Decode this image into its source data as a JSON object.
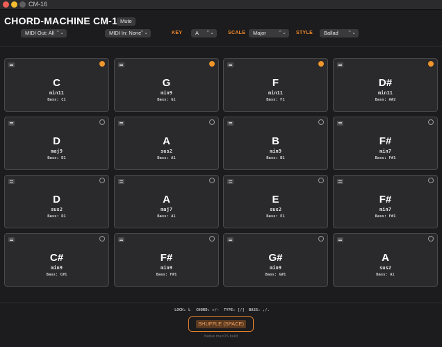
{
  "window": {
    "title": "CM-16"
  },
  "header": {
    "app_title": "CHORD-MACHINE CM-16",
    "mute_label": "Mute"
  },
  "controls": {
    "midi_out": "MIDI Out: All",
    "midi_in": "MIDI In: None",
    "key_label": "KEY",
    "key_value": "A",
    "scale_label": "SCALE",
    "scale_value": "Major",
    "style_label": "STYLE",
    "style_value": "Ballad"
  },
  "pads": [
    {
      "root": "C",
      "quality": "min11",
      "bass": "Bass: C1",
      "active": true
    },
    {
      "root": "G",
      "quality": "min9",
      "bass": "Bass: G1",
      "active": true
    },
    {
      "root": "F",
      "quality": "min11",
      "bass": "Bass: F1",
      "active": true
    },
    {
      "root": "D#",
      "quality": "min11",
      "bass": "Bass: A#2",
      "active": true
    },
    {
      "root": "D",
      "quality": "maj9",
      "bass": "Bass: D1",
      "active": false
    },
    {
      "root": "A",
      "quality": "sus2",
      "bass": "Bass: A1",
      "active": false
    },
    {
      "root": "B",
      "quality": "min9",
      "bass": "Bass: B1",
      "active": false
    },
    {
      "root": "F#",
      "quality": "min7",
      "bass": "Bass: F#1",
      "active": false
    },
    {
      "root": "D",
      "quality": "sus2",
      "bass": "Bass: D1",
      "active": false
    },
    {
      "root": "A",
      "quality": "maj7",
      "bass": "Bass: A1",
      "active": false
    },
    {
      "root": "E",
      "quality": "sus2",
      "bass": "Bass: E1",
      "active": false
    },
    {
      "root": "F#",
      "quality": "min7",
      "bass": "Bass: F#1",
      "active": false
    },
    {
      "root": "C#",
      "quality": "min9",
      "bass": "Bass: C#1",
      "active": false
    },
    {
      "root": "F#",
      "quality": "min9",
      "bass": "Bass: F#1",
      "active": false
    },
    {
      "root": "G#",
      "quality": "min9",
      "bass": "Bass: G#1",
      "active": false
    },
    {
      "root": "A",
      "quality": "sus2",
      "bass": "Bass: A1",
      "active": false
    }
  ],
  "hints": {
    "lock": "LOCK: L",
    "chord": "CHORD: +/-",
    "type": "TYPE: [/]",
    "bass": "BASS: ,/."
  },
  "shuffle_label": "SHUFFLE (SPACE)",
  "footer": "Native macOS build",
  "colors": {
    "accent": "#f0872b",
    "active_dot": "#f0962b",
    "background": "#1c1c1e",
    "pad": "#2a2a2c"
  }
}
